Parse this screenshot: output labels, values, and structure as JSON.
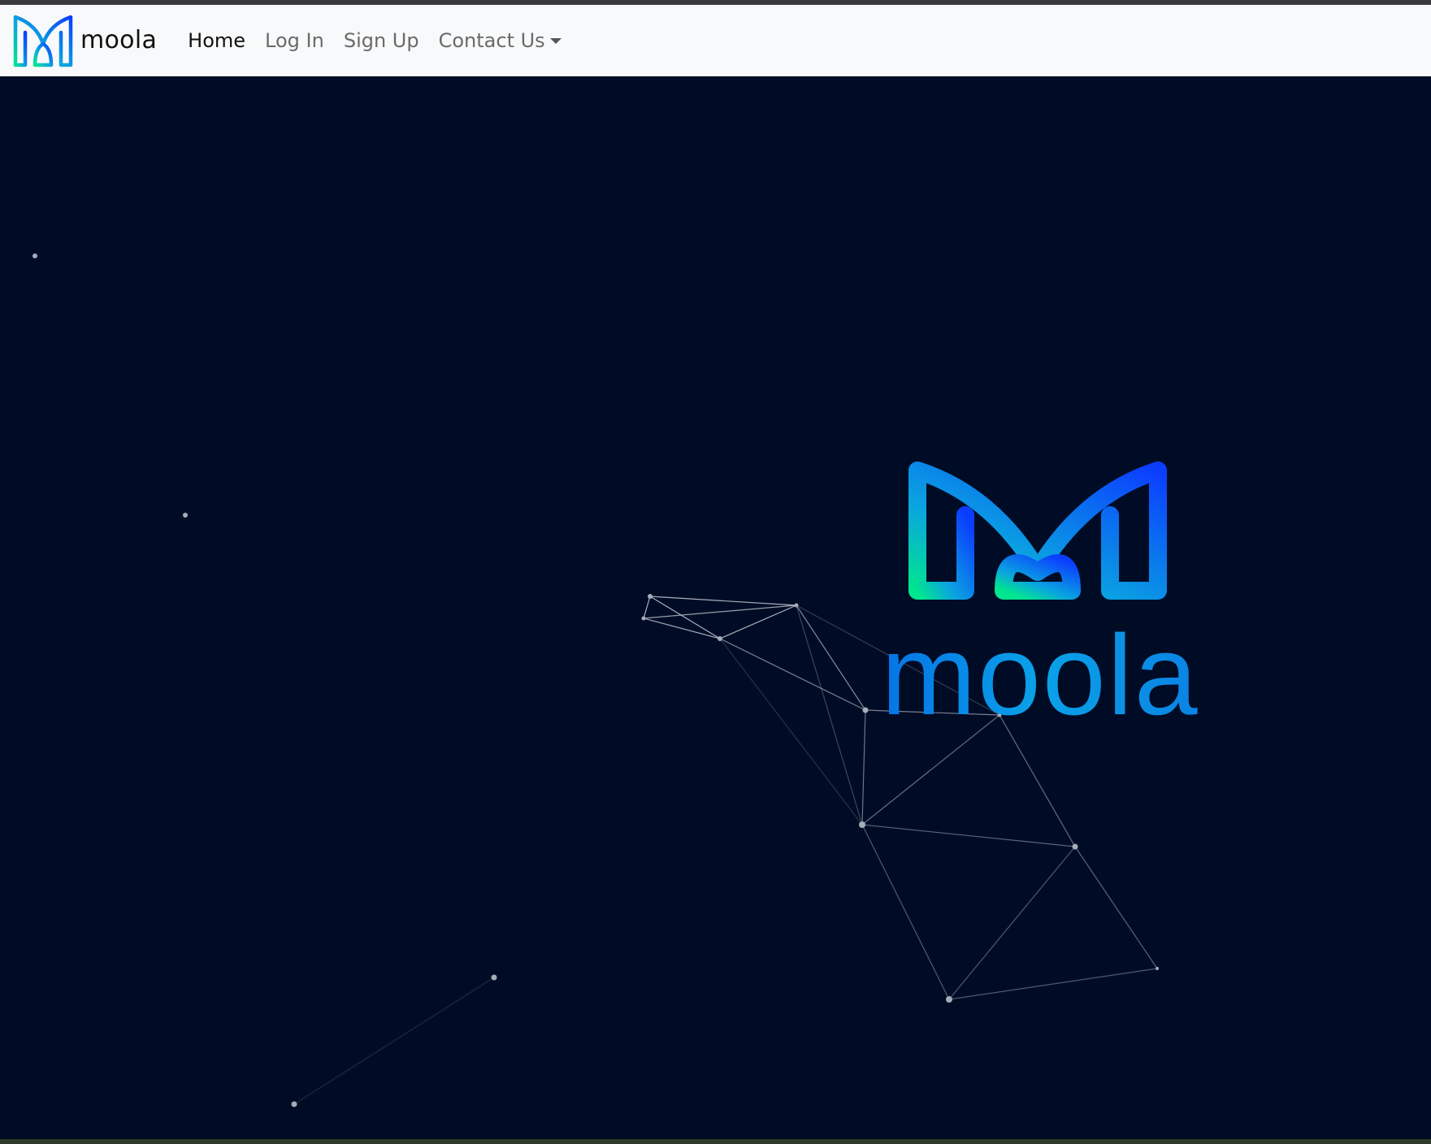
{
  "brand": {
    "name": "moola",
    "logo_icon": "moola-m-logo-icon"
  },
  "nav": {
    "home": "Home",
    "login": "Log In",
    "signup": "Sign Up",
    "contact": "Contact Us",
    "contact_icon": "caret-down-icon"
  },
  "hero": {
    "logo_text": "moola",
    "background_color": "#000c26",
    "gradient_start": "#00e58f",
    "gradient_mid": "#0aa4e0",
    "gradient_end": "#0b3dff"
  }
}
